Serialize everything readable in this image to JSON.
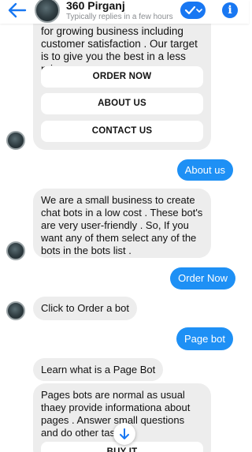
{
  "header": {
    "title": "360 Pirganj",
    "subtitle": "Typically replies in a few hours",
    "info_glyph": "i"
  },
  "messages": {
    "card_text": "for growing business including customer satisfaction . Our target is to give you the best in a less price .",
    "card_buttons": [
      "ORDER NOW",
      "ABOUT US",
      "CONTACT US"
    ],
    "user_about": "About us",
    "bot_about": "We are a small business to create chat bots in a low cost . These bot's are very user-friendly . So, If you want any of them select any of the bots in the bots list .",
    "user_order": "Order Now",
    "bot_order": "Click to Order a bot",
    "user_pagebot": "Page bot",
    "bot_learn": "Learn what is a Page Bot",
    "bot_pagebots": "Pages bots are normal as usual thaey provide informationa about pages . Answer small questions and do other tas",
    "partial_button": "BUY IT"
  },
  "colors": {
    "accent": "#1877f2",
    "outgoing_bubble": "#1e90f5",
    "incoming_bubble": "#ededed"
  },
  "icons": {
    "back": "arrow-left-icon",
    "check": "check-dropdown-icon",
    "info": "info-icon",
    "scroll": "arrow-down-icon"
  }
}
